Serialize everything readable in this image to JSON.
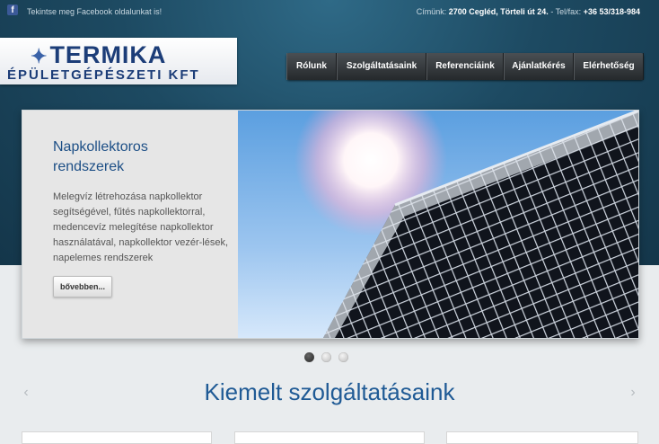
{
  "topbar": {
    "facebook_icon": "facebook-icon",
    "facebook_text": "Tekintse meg Facebook oldalunkat is!",
    "address_label": "Címünk:",
    "address": "2700 Cegléd, Törteli út 24.",
    "phone_label": " - Tel/fax:",
    "phone": "+36 53/318-984"
  },
  "logo": {
    "line1": "TERMIKA",
    "line2": "ÉPÜLETGÉPÉSZETI KFT"
  },
  "nav": {
    "items": [
      {
        "label": "Rólunk"
      },
      {
        "label": "Szolgáltatásaink"
      },
      {
        "label": "Referenciáink"
      },
      {
        "label": "Ajánlatkérés"
      },
      {
        "label": "Elérhetőség"
      }
    ]
  },
  "slide": {
    "title": "Napkollektoros rendszerek",
    "text": "Melegvíz létrehozása napkollektor segítségével, fűtés napkollektorral, medencevíz melegítése napkollektor használatával, napkollektor vezér-lések, napelemes rendszerek",
    "button": "bővebben...",
    "active_index": 0,
    "count": 3
  },
  "section": {
    "title": "Kiemelt szolgáltatásaink"
  },
  "colors": {
    "accent": "#1f5a95",
    "nav_bg": "#2f3336",
    "header_bg": "#1d4a62"
  }
}
